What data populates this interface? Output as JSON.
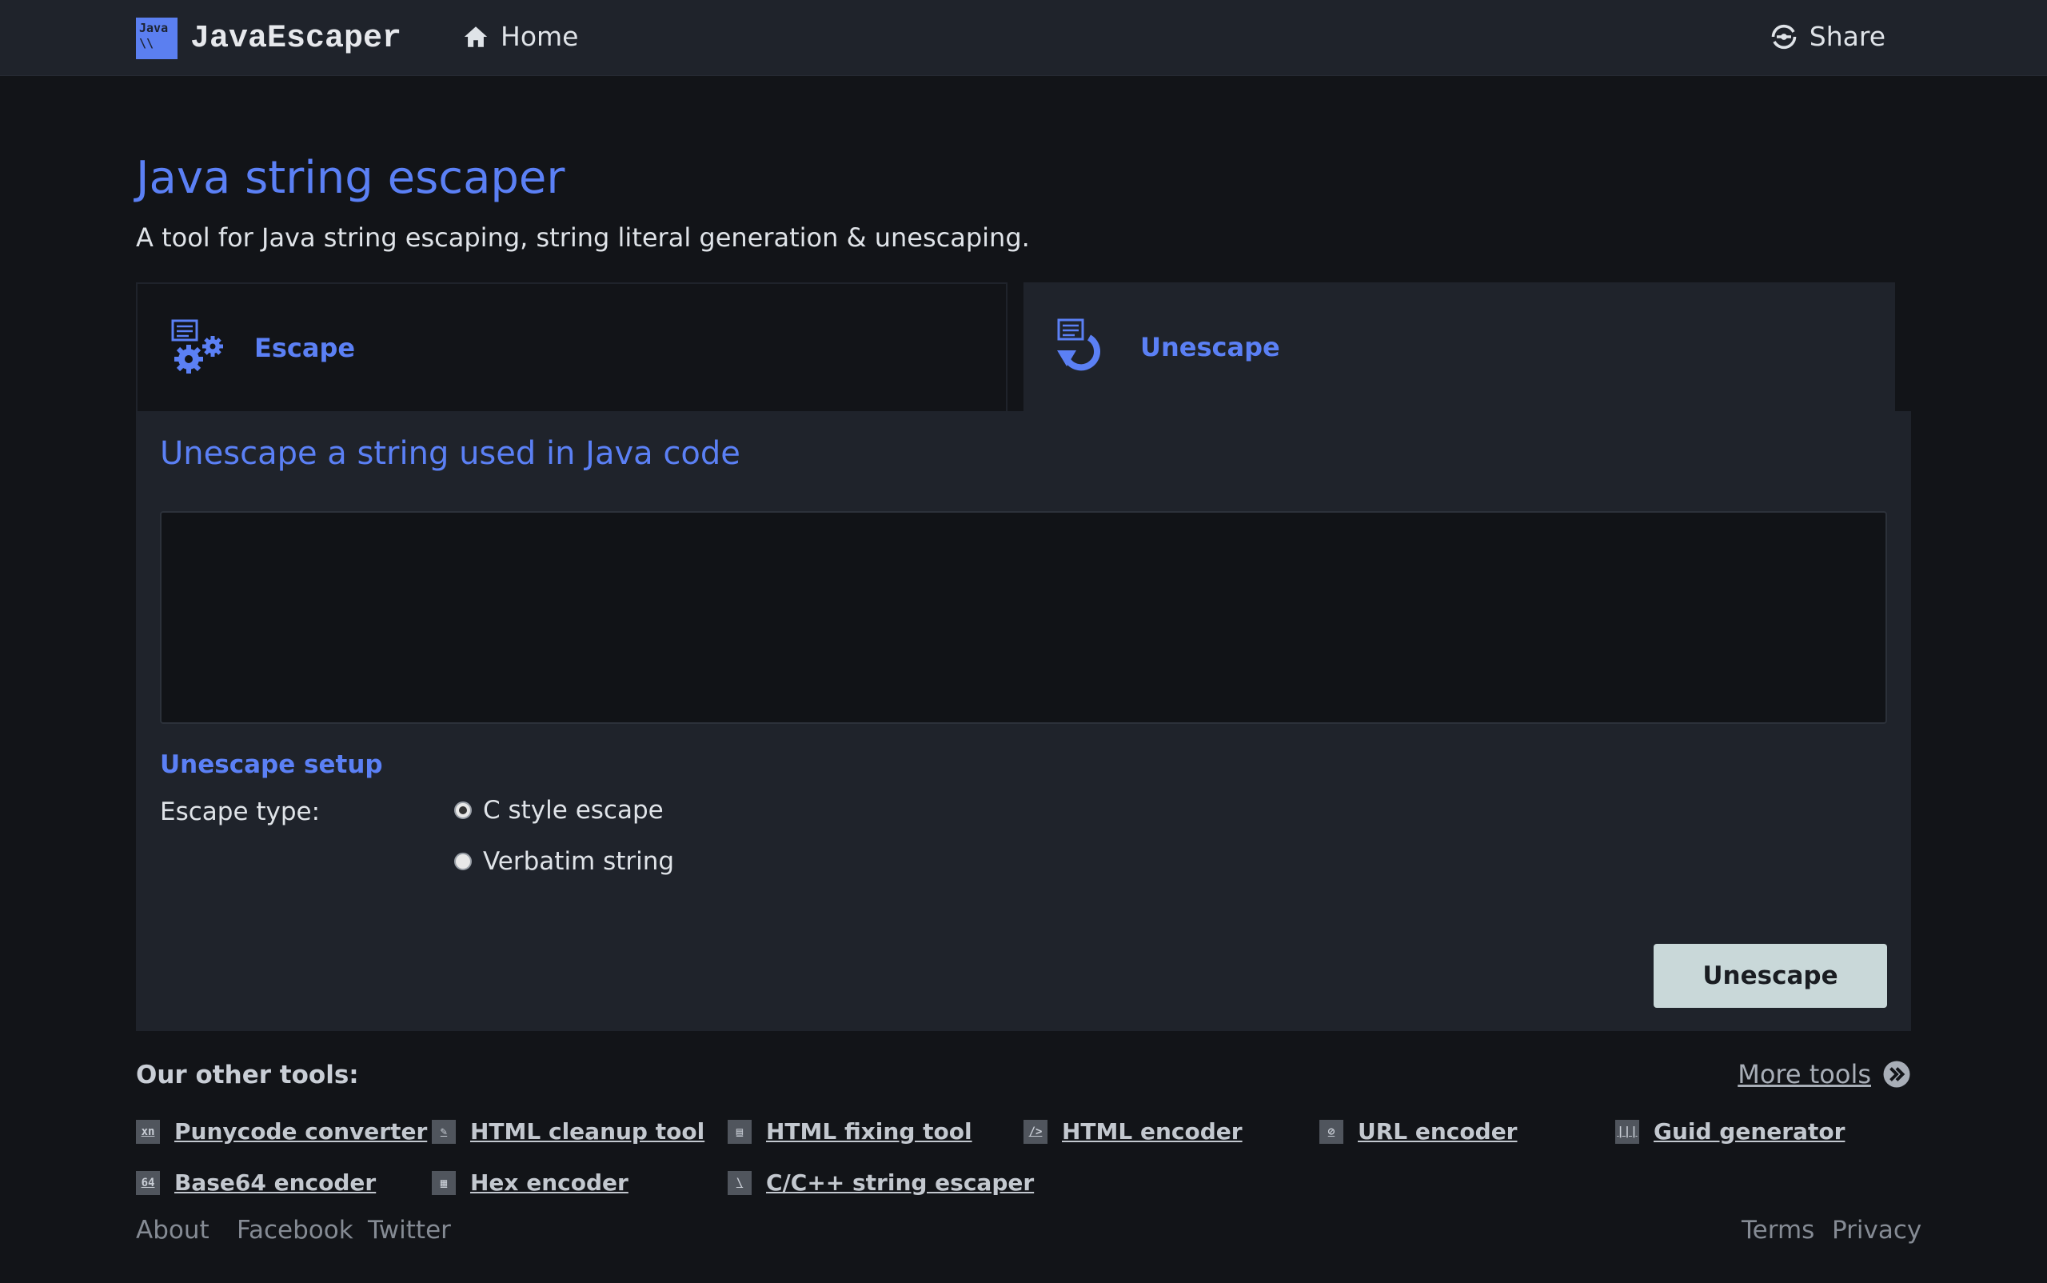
{
  "navbar": {
    "logo_text_line1": "Java",
    "logo_text_line2": "\\\\",
    "brand": "JavaEscaper",
    "home_label": "Home",
    "share_label": "Share"
  },
  "page": {
    "title": "Java string escaper",
    "subtitle": "A tool for Java string escaping, string literal generation & unescaping."
  },
  "tabs": [
    {
      "label": "Escape",
      "icon": "gears-document-icon",
      "active": false
    },
    {
      "label": "Unescape",
      "icon": "document-undo-icon",
      "active": true
    }
  ],
  "panel": {
    "heading": "Unescape a string used in Java code",
    "input_value": "",
    "setup_heading": "Unescape setup",
    "escape_type_label": "Escape type:",
    "options": [
      {
        "label": "C style escape",
        "checked": true
      },
      {
        "label": "Verbatim string",
        "checked": false
      }
    ],
    "button_label": "Unescape"
  },
  "other_tools": {
    "title": "Our other tools:",
    "more_label": "More tools",
    "tools": [
      {
        "label": "Punycode converter",
        "icon_text": "xn"
      },
      {
        "label": "HTML cleanup tool",
        "icon_text": "✎"
      },
      {
        "label": "HTML fixing tool",
        "icon_text": "▤"
      },
      {
        "label": "HTML encoder",
        "icon_text": "/>"
      },
      {
        "label": "URL encoder",
        "icon_text": "⊘"
      },
      {
        "label": "Guid generator",
        "icon_text": "|||"
      },
      {
        "label": "Base64 encoder",
        "icon_text": "64"
      },
      {
        "label": "Hex encoder",
        "icon_text": "▦"
      },
      {
        "label": "C/C++ string escaper",
        "icon_text": "\\"
      }
    ]
  },
  "footer": {
    "left": [
      "About",
      "Facebook",
      "Twitter"
    ],
    "right": [
      "Terms",
      "Privacy"
    ]
  },
  "colors": {
    "accent": "#5b80f5",
    "navbar_bg": "#1f232b",
    "page_bg": "#121418",
    "panel_bg": "#1f232b",
    "button_bg": "#c9d8d9"
  }
}
